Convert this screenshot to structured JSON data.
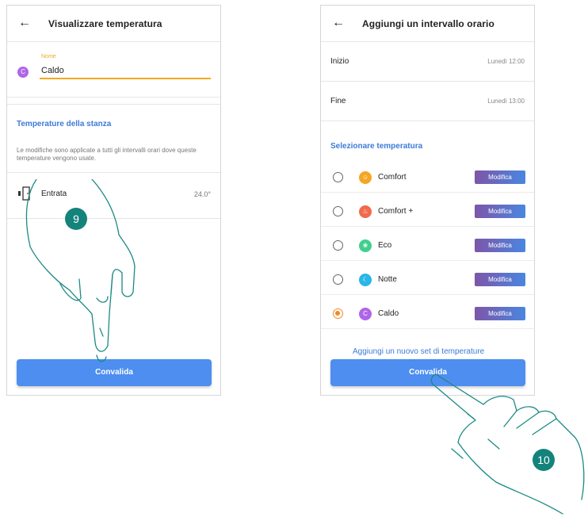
{
  "left_screen": {
    "title": "Visualizzare temperatura",
    "name_label": "Nome",
    "avatar_letter": "C",
    "name_value": "Caldo",
    "section_title": "Temperature della stanza",
    "note": "Le modifiche sono applicate a tutti gli intervalli orari dove queste temperature vengono usate.",
    "room": {
      "name": "Entrata",
      "temp": "24.0°"
    },
    "confirm_label": "Convalida"
  },
  "right_screen": {
    "title": "Aggiungi un intervallo orario",
    "start": {
      "label": "Inizio",
      "value": "Lunedì 12:00"
    },
    "end": {
      "label": "Fine",
      "value": "Lunedì 13:00"
    },
    "section_title": "Selezionare temperatura",
    "temperatures": [
      {
        "name": "Comfort",
        "color": "#f5a623",
        "checked": false,
        "edit": "Modifica"
      },
      {
        "name": "Comfort +",
        "color": "#f06a4c",
        "checked": false,
        "edit": "Modifica"
      },
      {
        "name": "Eco",
        "color": "#3fcf8e",
        "checked": false,
        "edit": "Modifica"
      },
      {
        "name": "Notte",
        "color": "#29b6e8",
        "checked": false,
        "edit": "Modifica"
      },
      {
        "name": "Caldo",
        "color": "#b065e8",
        "checked": true,
        "edit": "Modifica"
      }
    ],
    "add_link": "Aggiungi un nuovo set di temperature",
    "confirm_label": "Convalida"
  },
  "steps": {
    "left": "9",
    "right": "10"
  },
  "colors": {
    "primary": "#4d8ef0",
    "accent": "#f5a623",
    "badge": "#13837c"
  }
}
